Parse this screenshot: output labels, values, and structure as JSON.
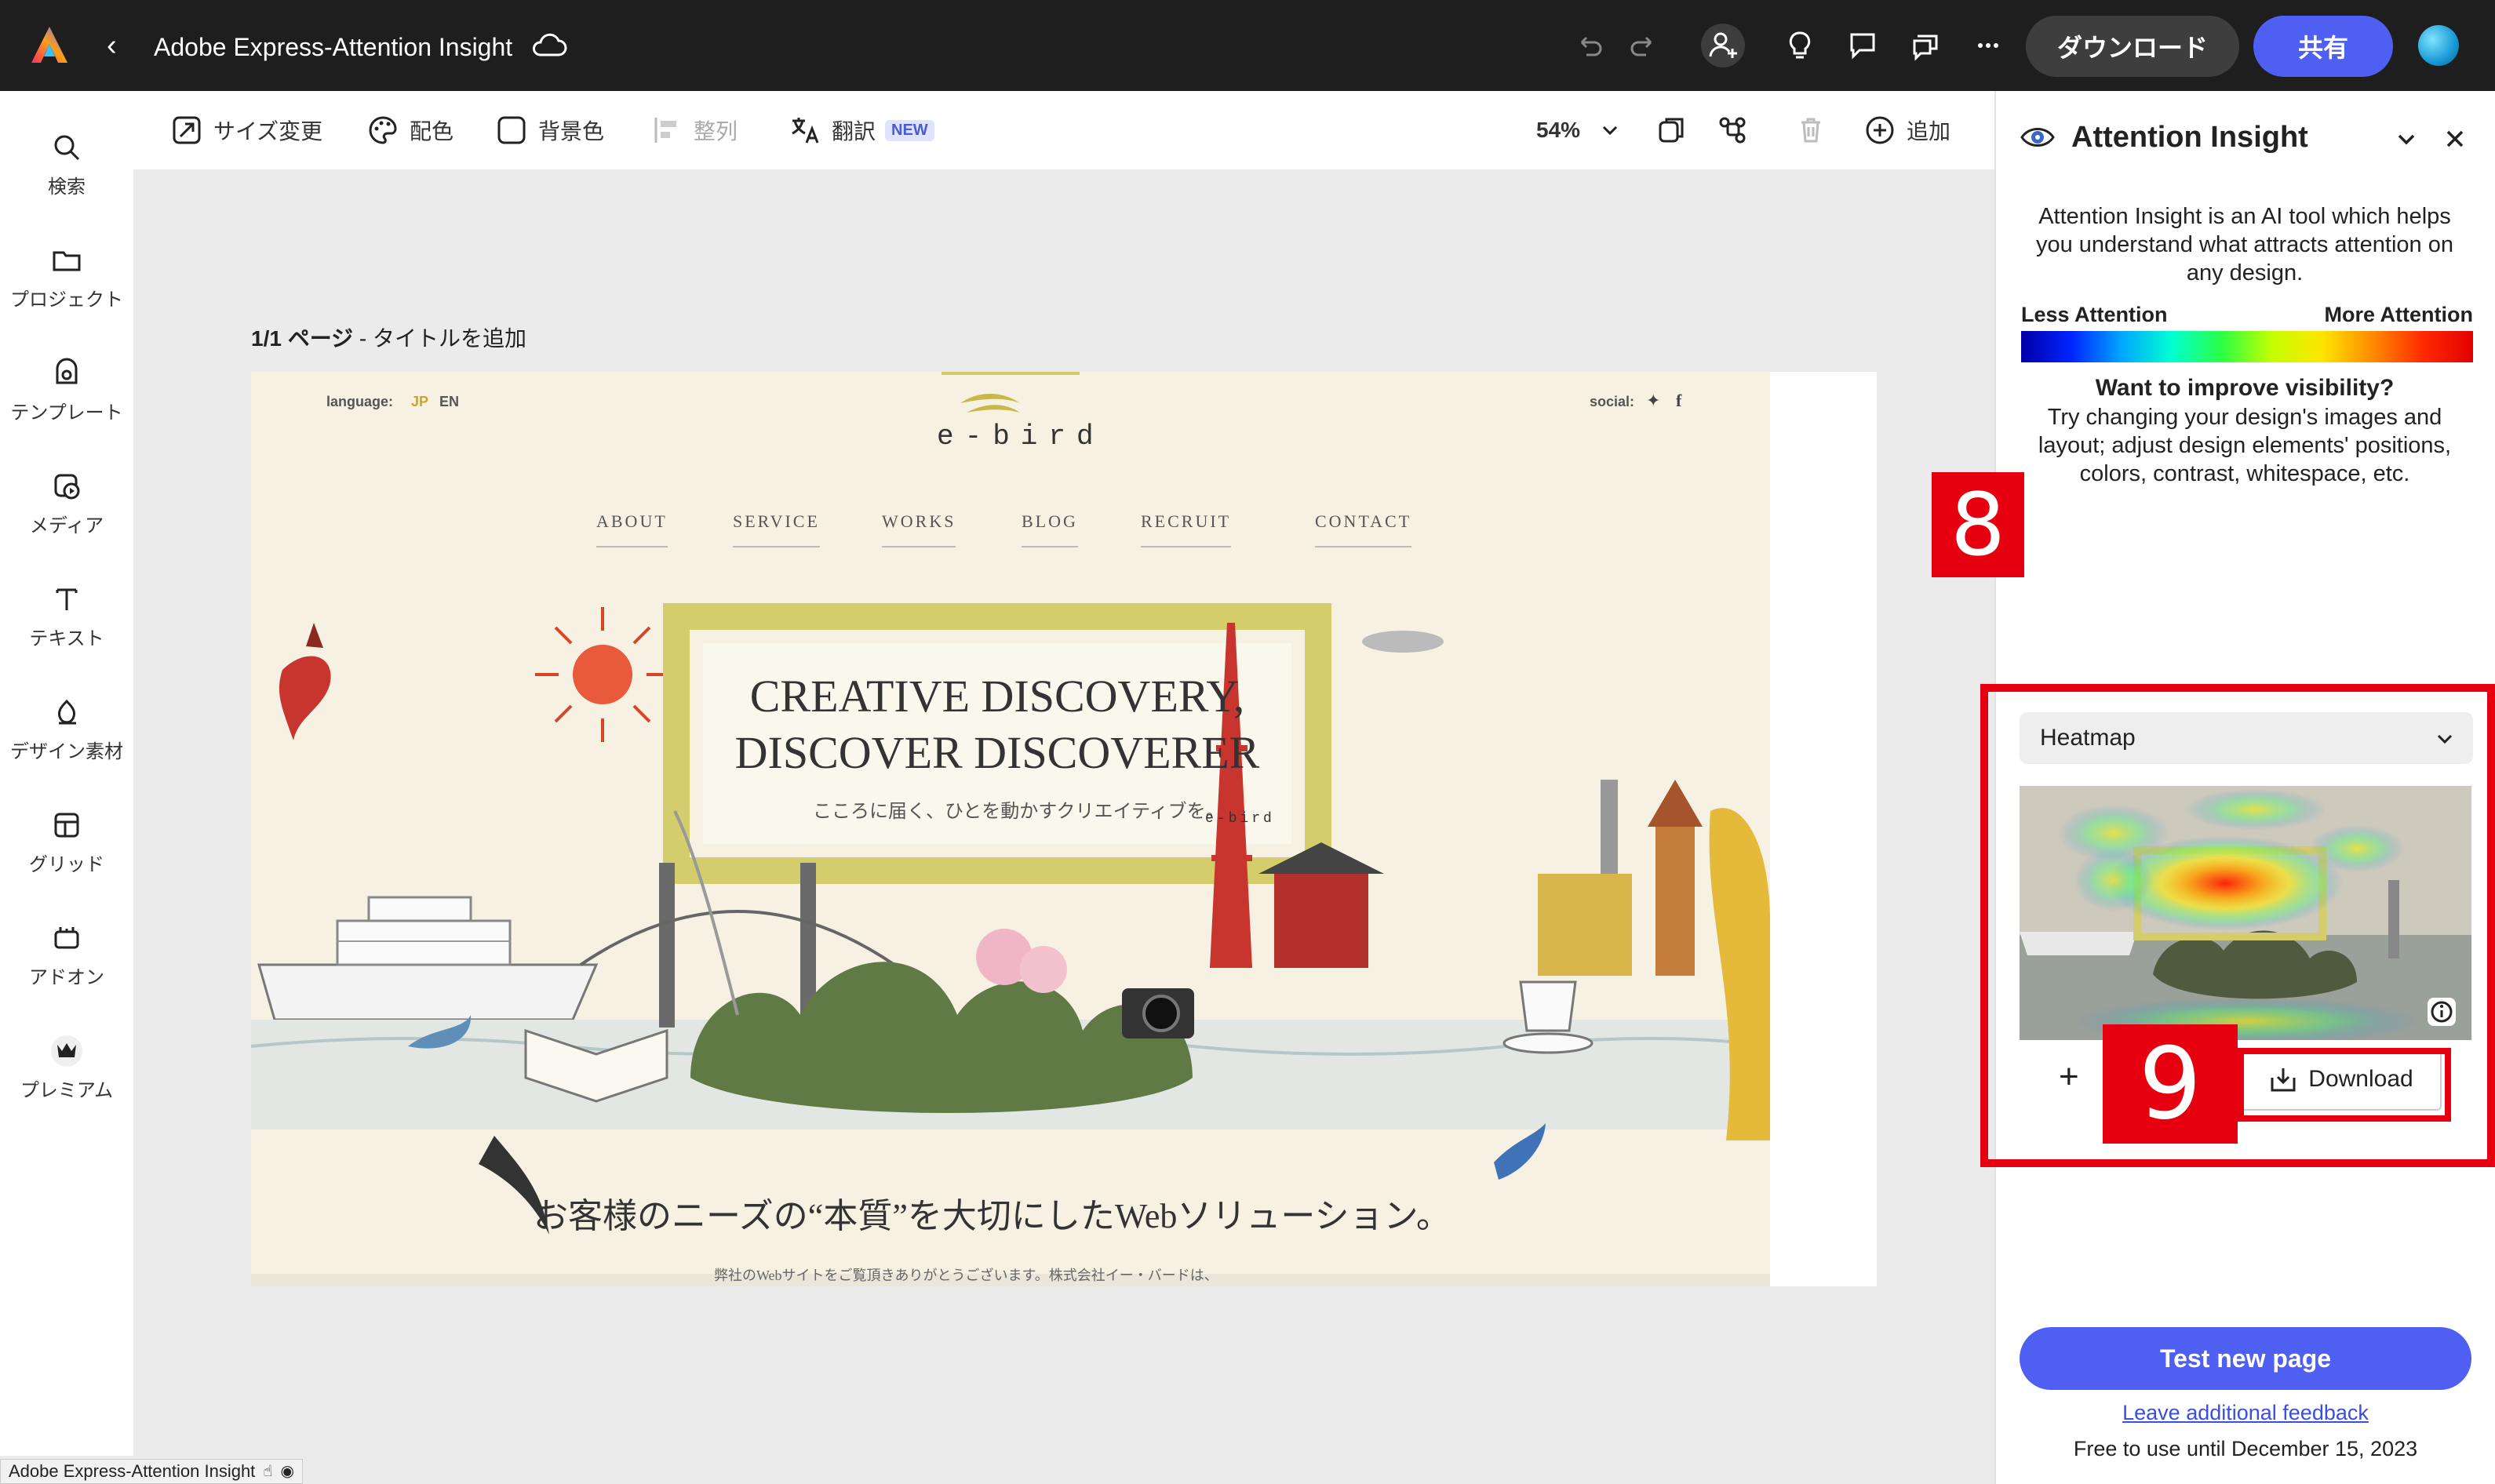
{
  "topbar": {
    "title": "Adobe Express-Attention Insight",
    "download_label": "ダウンロード",
    "share_label": "共有"
  },
  "leftrail": {
    "items": [
      {
        "label": "検索",
        "icon": "search-icon"
      },
      {
        "label": "プロジェクト",
        "icon": "folder-icon"
      },
      {
        "label": "テンプレート",
        "icon": "template-icon"
      },
      {
        "label": "メディア",
        "icon": "media-icon"
      },
      {
        "label": "テキスト",
        "icon": "text-icon"
      },
      {
        "label": "デザイン素材",
        "icon": "shapes-icon"
      },
      {
        "label": "グリッド",
        "icon": "grid-icon"
      },
      {
        "label": "アドオン",
        "icon": "addon-icon"
      },
      {
        "label": "プレミアム",
        "icon": "crown-icon"
      }
    ]
  },
  "toolbar": {
    "resize": "サイズ変更",
    "color": "配色",
    "background": "背景色",
    "align": "整列",
    "translate": "翻訳",
    "new_badge": "NEW",
    "zoom": "54%",
    "add": "追加"
  },
  "canvas": {
    "page_label_bold": "1/1 ページ",
    "page_label_rest": " - タイトルを追加",
    "artwork": {
      "language_label": "language:",
      "lang_jp": "JP",
      "lang_en": "EN",
      "social_label": "social:",
      "logo": "e-bird",
      "nav": [
        "ABOUT",
        "SERVICE",
        "WORKS",
        "BLOG",
        "RECRUIT",
        "CONTACT"
      ],
      "headline_1": "CREATIVE DISCOVERY,",
      "headline_2": "DISCOVER DISCOVERER",
      "tagline": "こころに届く、ひとを動かすクリエイティブを。",
      "tagline_logo": "e-bird",
      "bottom_heading": "お客様のニーズの“本質”を大切にしたWebソリューション。",
      "bottom_small": "弊社のWebサイトをご覧頂きありがとうございます。株式会社イー・バードは、"
    }
  },
  "panel": {
    "title": "Attention Insight",
    "description": "Attention Insight is an AI tool which helps you understand what attracts attention on any design.",
    "legend_less": "Less Attention",
    "legend_more": "More Attention",
    "visibility_title": "Want to improve visibility?",
    "visibility_desc": "Try changing your design's images and layout; adjust design elements' positions, colors, contrast, whitespace, etc.",
    "view_select": "Heatmap",
    "download_label": "Download",
    "test_button": "Test new page",
    "feedback_link": "Leave additional feedback",
    "free_note": "Free to use until December 15, 2023"
  },
  "annotations": {
    "step_8": "8",
    "step_9": "9"
  },
  "statusbar": {
    "text": "Adobe Express-Attention Insight"
  },
  "colors": {
    "accent": "#4f5ff2",
    "annotation_red": "#e6000f",
    "topbar": "#1e1e1e"
  }
}
